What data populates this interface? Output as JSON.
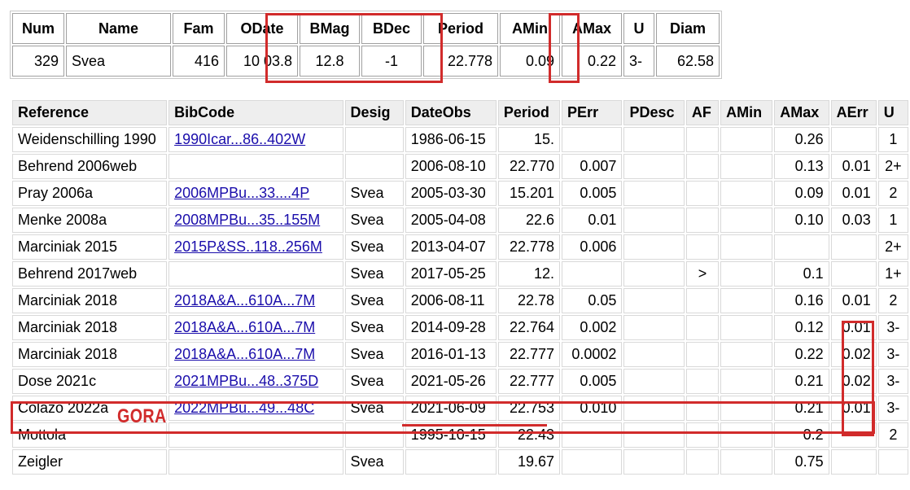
{
  "summary": {
    "headers": [
      "Num",
      "Name",
      "Fam",
      "ODate",
      "BMag",
      "BDec",
      "Period",
      "AMin",
      "AMax",
      "U",
      "Diam"
    ],
    "values": [
      "329",
      "Svea",
      "416",
      "10 03.8",
      "12.8",
      "-1",
      "22.778",
      "0.09",
      "0.22",
      "3-",
      "62.58"
    ]
  },
  "refs": {
    "headers": [
      "Reference",
      "BibCode",
      "Desig",
      "DateObs",
      "Period",
      "PErr",
      "PDesc",
      "AF",
      "AMin",
      "AMax",
      "AErr",
      "U"
    ],
    "rows": [
      [
        "Weidenschilling 1990",
        "1990Icar...86..402W",
        "",
        "1986-06-15",
        "15.",
        "",
        "",
        "",
        "",
        "0.26",
        "",
        "1"
      ],
      [
        "Behrend 2006web",
        "",
        "",
        "2006-08-10",
        "22.770",
        "0.007",
        "",
        "",
        "",
        "0.13",
        "0.01",
        "2+"
      ],
      [
        "Pray 2006a",
        "2006MPBu...33....4P",
        "Svea",
        "2005-03-30",
        "15.201",
        "0.005",
        "",
        "",
        "",
        "0.09",
        "0.01",
        "2"
      ],
      [
        "Menke 2008a",
        "2008MPBu...35..155M",
        "Svea",
        "2005-04-08",
        "22.6",
        "0.01",
        "",
        "",
        "",
        "0.10",
        "0.03",
        "1"
      ],
      [
        "Marciniak 2015",
        "2015P&SS..118..256M",
        "Svea",
        "2013-04-07",
        "22.778",
        "0.006",
        "",
        "",
        "",
        "",
        "",
        "2+"
      ],
      [
        "Behrend 2017web",
        "",
        "Svea",
        "2017-05-25",
        "12.",
        "",
        "",
        ">",
        "",
        "0.1",
        "",
        "1+"
      ],
      [
        "Marciniak 2018",
        "2018A&A...610A...7M",
        "Svea",
        "2006-08-11",
        "22.78",
        "0.05",
        "",
        "",
        "",
        "0.16",
        "0.01",
        "2"
      ],
      [
        "Marciniak 2018",
        "2018A&A...610A...7M",
        "Svea",
        "2014-09-28",
        "22.764",
        "0.002",
        "",
        "",
        "",
        "0.12",
        "0.01",
        "3-"
      ],
      [
        "Marciniak 2018",
        "2018A&A...610A...7M",
        "Svea",
        "2016-01-13",
        "22.777",
        "0.0002",
        "",
        "",
        "",
        "0.22",
        "0.02",
        "3-"
      ],
      [
        "Dose 2021c",
        "2021MPBu...48..375D",
        "Svea",
        "2021-05-26",
        "22.777",
        "0.005",
        "",
        "",
        "",
        "0.21",
        "0.02",
        "3-"
      ],
      [
        "Colazo 2022a",
        "2022MPBu...49...48C",
        "Svea",
        "2021-06-09",
        "22.753",
        "0.010",
        "",
        "",
        "",
        "0.21",
        "0.01",
        "3-"
      ],
      [
        "Mottola",
        "",
        "",
        "1995-10-15",
        "22.43",
        "",
        "",
        "",
        "",
        "0.2",
        "",
        "2"
      ],
      [
        "Zeigler",
        "",
        "Svea",
        "",
        "19.67",
        "",
        "",
        "",
        "",
        "0.75",
        "",
        ""
      ]
    ]
  },
  "annotation": {
    "gora_label": "GORA",
    "highlight_color": "#d12b2b",
    "link_color": "#1a0dab"
  }
}
